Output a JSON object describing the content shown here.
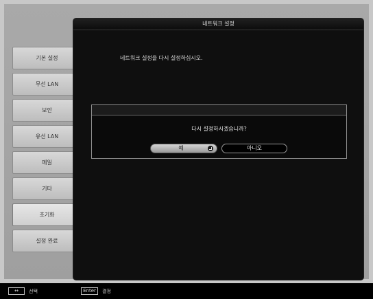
{
  "panel": {
    "title": "네트워크 설정",
    "message": "네트워크 설정을 다시 설정하십시오."
  },
  "sidebar": {
    "items": [
      {
        "label": "기본 설정"
      },
      {
        "label": "무선 LAN"
      },
      {
        "label": "보안"
      },
      {
        "label": "유선 LAN"
      },
      {
        "label": "메일"
      },
      {
        "label": "기타"
      },
      {
        "label": "초기화"
      },
      {
        "label": "설정 완료"
      }
    ],
    "active_index": 6
  },
  "dialog": {
    "question": "다시 설정하시겠습니까?",
    "yes_label": "예",
    "no_label": "아니오",
    "enter_icon": "enter-icon"
  },
  "footer": {
    "arrow_key": "↔",
    "arrow_label": "선택",
    "enter_key": "Enter",
    "enter_label": "결정"
  }
}
